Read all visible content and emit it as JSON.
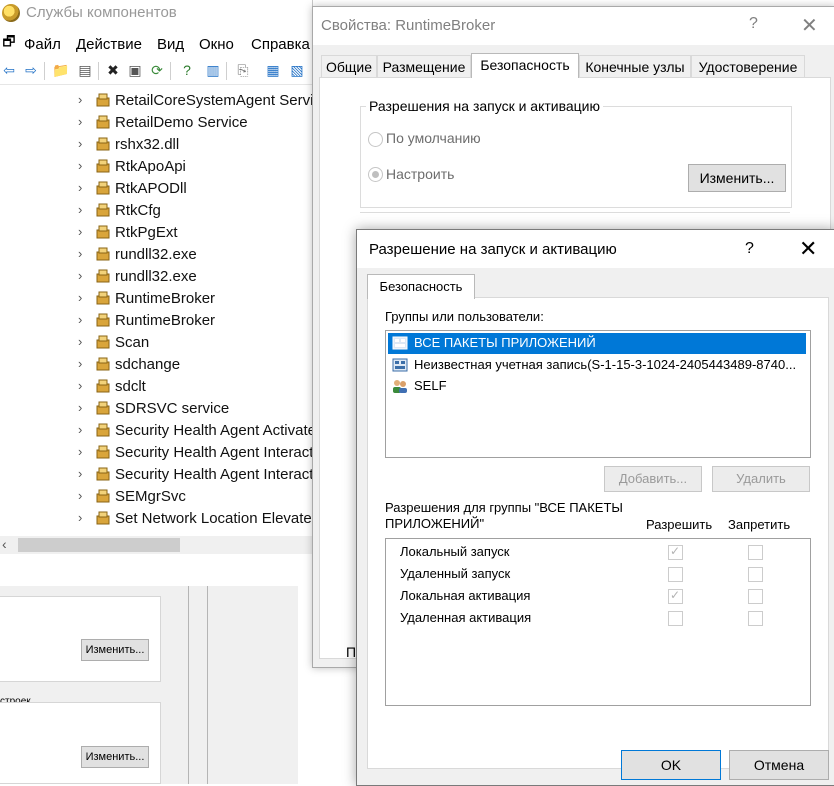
{
  "component_services": {
    "title": "Службы компонентов",
    "menu": [
      "Файл",
      "Действие",
      "Вид",
      "Окно",
      "Справка"
    ],
    "tree_items": [
      "RetailCoreSystemAgent Servic",
      "RetailDemo Service",
      "rshx32.dll",
      "RtkApoApi",
      "RtkAPODll",
      "RtkCfg",
      "RtkPgExt",
      "rundll32.exe",
      "rundll32.exe",
      "RuntimeBroker",
      "RuntimeBroker",
      "Scan",
      "sdchange",
      "sdclt",
      "SDRSVC service",
      "Security Health Agent Activate",
      "Security Health Agent Interact",
      "Security Health Agent Interact",
      "SEMgrSvc",
      "Set Network Location Elevated"
    ],
    "lower_panel": {
      "edit_button_1": "Изменить...",
      "edit_button_2": "Изменить...",
      "group_label_fragment": "строек"
    }
  },
  "properties_dialog": {
    "title": "Свойства: RuntimeBroker",
    "help": "?",
    "close": "✕",
    "tabs": [
      "Общие",
      "Размещение",
      "Безопасность",
      "Конечные узлы",
      "Удостоверение"
    ],
    "active_tab": "Безопасность",
    "launch_group_label": "Разрешения на запуск и активацию",
    "radio_default": "По умолчанию",
    "radio_custom": "Настроить",
    "edit_button": "Изменить...",
    "bottom_label_fragment": "По"
  },
  "permission_dialog": {
    "title": "Разрешение на запуск и активацию",
    "help": "?",
    "close": "✕",
    "tab": "Безопасность",
    "groups_label": "Группы или пользователи:",
    "groups": [
      {
        "label": "ВСЕ ПАКЕТЫ ПРИЛОЖЕНИЙ",
        "icon": "app-package-icon",
        "selected": true
      },
      {
        "label": "Неизвестная учетная запись(S-1-15-3-1024-2405443489-8740...",
        "icon": "unknown-account-icon",
        "selected": false
      },
      {
        "label": "SELF",
        "icon": "users-icon",
        "selected": false
      }
    ],
    "add_button": "Добавить...",
    "remove_button": "Удалить",
    "permissions_for_label": "Разрешения для группы \"ВСЕ ПАКЕТЫ ПРИЛОЖЕНИЙ\"",
    "allow_header": "Разрешить",
    "deny_header": "Запретить",
    "permissions": [
      {
        "label": "Локальный запуск",
        "allow": true,
        "deny": false
      },
      {
        "label": "Удаленный запуск",
        "allow": false,
        "deny": false
      },
      {
        "label": "Локальная активация",
        "allow": true,
        "deny": false
      },
      {
        "label": "Удаленная активация",
        "allow": false,
        "deny": false
      }
    ],
    "ok_button": "OK",
    "cancel_button": "Отмена"
  },
  "colors": {
    "selection": "#0078d7",
    "window_bg": "#f0f0f0",
    "disabled_text": "#9a9a9a"
  }
}
